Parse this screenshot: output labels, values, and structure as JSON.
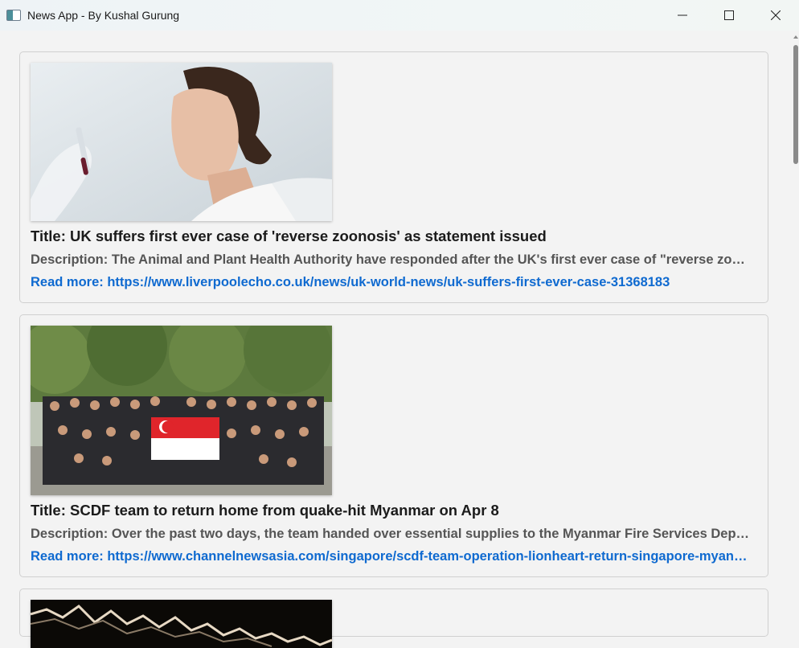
{
  "window": {
    "title": "News App - By Kushal Gurung",
    "icon": "app-window-icon"
  },
  "articles": [
    {
      "title": "Title: UK suffers first ever case of 'reverse zoonosis' as statement issued",
      "description": "Description: The Animal and Plant Health Authority have responded after the UK's first ever case of \"reverse zoonosis\"",
      "link": "Read more: https://www.liverpoolecho.co.uk/news/uk-world-news/uk-suffers-first-ever-case-31368183",
      "image": "scientist-holding-test-tube-photo"
    },
    {
      "title": "Title: SCDF team to return home from quake-hit Myanmar on Apr 8",
      "description": "Description: Over the past two days, the team handed over essential supplies to the Myanmar Fire Services Department",
      "link": "Read more: https://www.channelnewsasia.com/singapore/scdf-team-operation-lionheart-return-singapore-myanmar",
      "image": "scdf-team-group-photo-with-singapore-flag"
    },
    {
      "image": "stock-market-chart-photo"
    }
  ]
}
